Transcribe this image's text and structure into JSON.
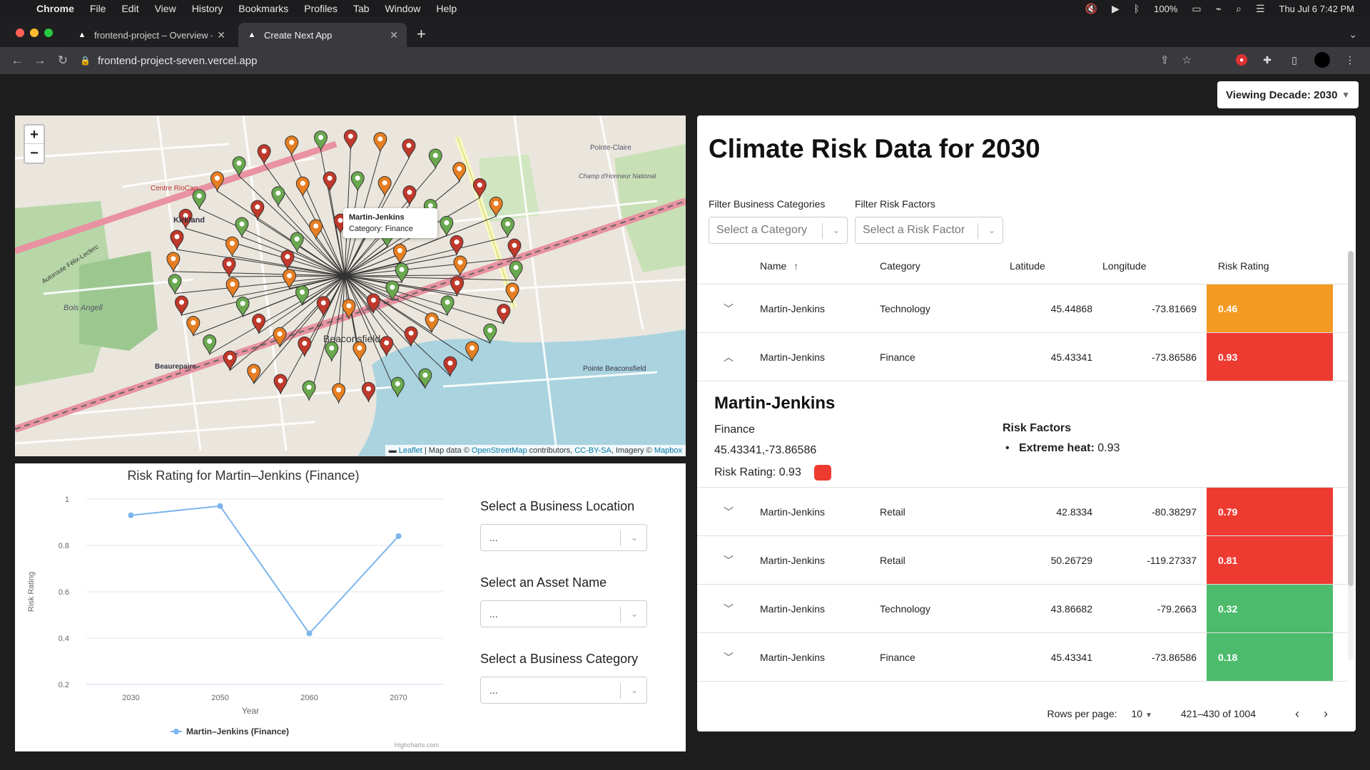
{
  "menubar": {
    "app": "Chrome",
    "items": [
      "File",
      "Edit",
      "View",
      "History",
      "Bookmarks",
      "Profiles",
      "Tab",
      "Window",
      "Help"
    ],
    "battery": "100%",
    "clock": "Thu Jul 6  7:42 PM"
  },
  "browser": {
    "tabs": [
      {
        "label": "frontend-project – Overview –",
        "active": false
      },
      {
        "label": "Create Next App",
        "active": true
      }
    ],
    "url": "frontend-project-seven.vercel.app"
  },
  "page": {
    "decade_label": "Viewing Decade: 2030",
    "map": {
      "popup_title": "Martin-Jenkins",
      "popup_category": "Category: Finance",
      "attribution": {
        "leaflet": "Leaflet",
        "map_data": "| Map data ©",
        "osm": "OpenStreetMap",
        "contributors": "contributors,",
        "license": "CC-BY-SA",
        "imagery": ", Imagery ©",
        "mapbox": "Mapbox"
      },
      "place_labels": [
        "Kirkland",
        "Centre RioCan",
        "Bois Angell",
        "Beaurepaire",
        "Beaconsfield",
        "Pointe Beaconsfield",
        "Pointe-Claire",
        "Champ d'Honneur National",
        "Autoroute Félix-Leclerc"
      ],
      "zoom_in": "+",
      "zoom_out": "−"
    },
    "chart": {
      "title": "Risk Rating for Martin–Jenkins (Finance)",
      "xlabel": "Year",
      "ylabel": "Risk Rating",
      "legend": "Martin–Jenkins (Finance)",
      "credit": "Highcharts.com"
    },
    "selects": [
      {
        "label": "Select a Business Location",
        "value": "..."
      },
      {
        "label": "Select an Asset Name",
        "value": "..."
      },
      {
        "label": "Select a Business Category",
        "value": "..."
      }
    ],
    "table": {
      "title": "Climate Risk Data for 2030",
      "filter_category_label": "Filter Business Categories",
      "filter_category_placeholder": "Select a Category",
      "filter_risk_label": "Filter Risk Factors",
      "filter_risk_placeholder": "Select a Risk Factor",
      "columns": [
        "Name",
        "Category",
        "Latitude",
        "Longitude",
        "Risk Rating"
      ],
      "rows": [
        {
          "name": "Martin-Jenkins",
          "category": "Technology",
          "lat": "45.44868",
          "lon": "-73.81669",
          "risk": "0.46",
          "color": "#f39a22",
          "expanded": false
        },
        {
          "name": "Martin-Jenkins",
          "category": "Finance",
          "lat": "45.43341",
          "lon": "-73.86586",
          "risk": "0.93",
          "color": "#ee3b32",
          "expanded": true
        },
        {
          "name": "Martin-Jenkins",
          "category": "Retail",
          "lat": "42.8334",
          "lon": "-80.38297",
          "risk": "0.79",
          "color": "#ee3b32",
          "expanded": false
        },
        {
          "name": "Martin-Jenkins",
          "category": "Retail",
          "lat": "50.26729",
          "lon": "-119.27337",
          "risk": "0.81",
          "color": "#ee3b32",
          "expanded": false
        },
        {
          "name": "Martin-Jenkins",
          "category": "Technology",
          "lat": "43.86682",
          "lon": "-79.2663",
          "risk": "0.32",
          "color": "#4cbb6c",
          "expanded": false
        },
        {
          "name": "Martin-Jenkins",
          "category": "Finance",
          "lat": "45.43341",
          "lon": "-73.86586",
          "risk": "0.18",
          "color": "#4cbb6c",
          "expanded": false
        }
      ],
      "detail": {
        "name": "Martin-Jenkins",
        "category": "Finance",
        "coords": "45.43341,-73.86586",
        "risk_rating": "Risk Rating: 0.93",
        "risk_factors_title": "Risk Factors",
        "factor_name": "Extreme heat:",
        "factor_value": "0.93"
      },
      "rows_per_page_label": "Rows per page:",
      "rows_per_page": "10",
      "range": "421–430 of 1004"
    }
  },
  "chart_data": {
    "type": "line",
    "title": "Risk Rating for Martin–Jenkins (Finance)",
    "xlabel": "Year",
    "ylabel": "Risk Rating",
    "categories": [
      "2030",
      "2050",
      "2060",
      "2070"
    ],
    "series": [
      {
        "name": "Martin–Jenkins (Finance)",
        "values": [
          0.93,
          0.97,
          0.42,
          0.84
        ]
      }
    ],
    "ylim": [
      0.2,
      1
    ],
    "yticks": [
      0.2,
      0.4,
      0.6,
      0.8,
      1
    ],
    "grid": true,
    "legend": "bottom-center"
  },
  "colors": {
    "risk_high": "#ee3b32",
    "risk_mid": "#f39a22",
    "risk_low": "#4cbb6c",
    "series_line": "#7cb5ec"
  }
}
